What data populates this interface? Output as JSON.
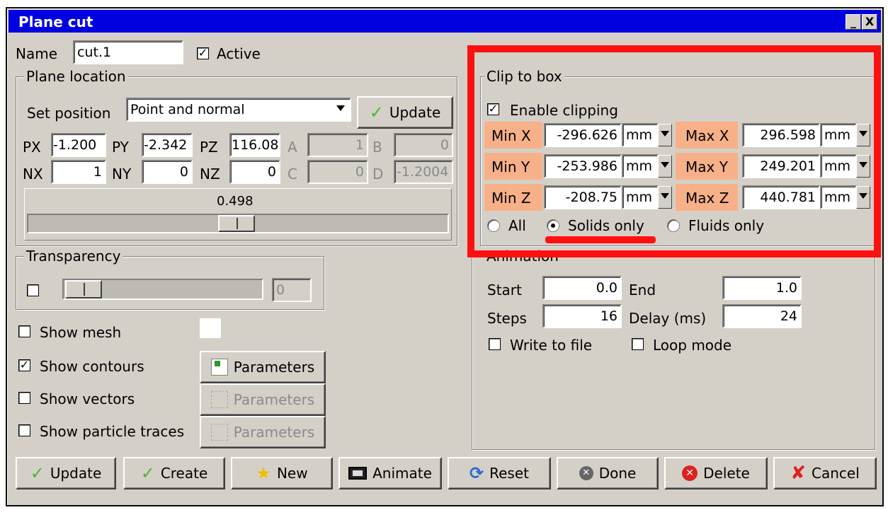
{
  "window": {
    "title": "Plane cut",
    "minimize_glyph": "_",
    "close_glyph": "X"
  },
  "top": {
    "name_label": "Name",
    "name_value": "cut.1",
    "active_label": "Active",
    "active_checked": true
  },
  "plane_location": {
    "group_title": "Plane location",
    "set_position_label": "Set position",
    "set_position_value": "Point and normal",
    "update_label": "Update",
    "px_label": "PX",
    "px_value": "-1.200",
    "py_label": "PY",
    "py_value": "-2.342",
    "pz_label": "PZ",
    "pz_value": "116.08",
    "a_label": "A",
    "a_value": "1",
    "b_label": "B",
    "b_value": "0",
    "nx_label": "NX",
    "nx_value": "1",
    "ny_label": "NY",
    "ny_value": "0",
    "nz_label": "NZ",
    "nz_value": "0",
    "c_label": "C",
    "c_value": "0",
    "d_label": "D",
    "d_value": "-1.2004",
    "slider_value": "0.498"
  },
  "transparency": {
    "group_title": "Transparency",
    "enabled": false,
    "value": "0"
  },
  "display": {
    "show_mesh": "Show mesh",
    "show_contours": "Show contours",
    "show_vectors": "Show vectors",
    "show_particle_traces": "Show particle traces",
    "parameters": "Parameters",
    "show_mesh_checked": false,
    "show_contours_checked": true,
    "show_vectors_checked": false,
    "show_particle_traces_checked": false
  },
  "clip_to_box": {
    "group_title": "Clip to box",
    "enable_label": "Enable clipping",
    "enabled": true,
    "unit": "mm",
    "min_x_label": "Min X",
    "min_x_value": "-296.626",
    "min_y_label": "Min Y",
    "min_y_value": "-253.986",
    "min_z_label": "Min Z",
    "min_z_value": "-208.75",
    "max_x_label": "Max X",
    "max_x_value": "296.598",
    "max_y_label": "Max Y",
    "max_y_value": "249.201",
    "max_z_label": "Max Z",
    "max_z_value": "440.781",
    "radio_all": "All",
    "radio_solids": "Solids only",
    "radio_fluids": "Fluids only",
    "selected": "Solids only"
  },
  "animation": {
    "group_title": "Animation",
    "start_label": "Start",
    "start_value": "0.0",
    "end_label": "End",
    "end_value": "1.0",
    "steps_label": "Steps",
    "steps_value": "16",
    "delay_label": "Delay (ms)",
    "delay_value": "24",
    "write_to_file": "Write to file",
    "loop_mode": "Loop mode"
  },
  "footer": {
    "update": "Update",
    "create": "Create",
    "new": "New",
    "animate": "Animate",
    "reset": "Reset",
    "done": "Done",
    "delete": "Delete",
    "cancel": "Cancel"
  },
  "colors": {
    "highlight": "#ff1010",
    "label_bg": "#f8b088",
    "title_bar": "#0000e0"
  }
}
